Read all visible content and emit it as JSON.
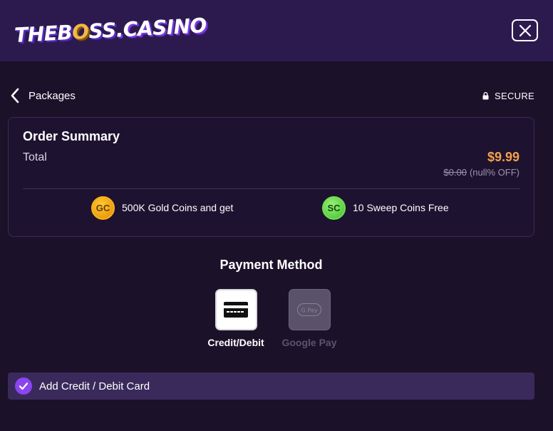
{
  "header": {
    "logo": {
      "part1": "THEB",
      "part2": "O",
      "part3": "SS",
      "part4": ".CASINO"
    },
    "close_icon": "close-icon"
  },
  "nav": {
    "back_label": "Packages",
    "secure_label": "SECURE"
  },
  "order_summary": {
    "title": "Order Summary",
    "total_label": "Total",
    "price": "$9.99",
    "original_price": "$0.00",
    "discount": "(null% OFF)",
    "items": [
      {
        "coin": "GC",
        "text": "500K Gold Coins and get"
      },
      {
        "coin": "SC",
        "text": "10 Sweep Coins Free"
      }
    ]
  },
  "payment": {
    "title": "Payment Method",
    "methods": [
      {
        "label": "Credit/Debit",
        "icon": "credit-card-icon",
        "state": "selected"
      },
      {
        "label": "Google Pay",
        "icon": "google-pay-icon",
        "badge": "G Pay",
        "state": "disabled"
      }
    ],
    "add_card_label": "Add Credit / Debit Card"
  },
  "colors": {
    "accent": "#8b45f0",
    "price": "#f5a04a",
    "background": "#1b1129",
    "header": "#2c1a4f"
  }
}
